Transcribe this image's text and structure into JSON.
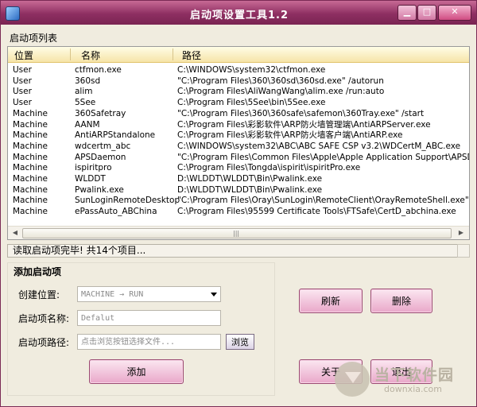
{
  "window": {
    "title": "启动项设置工具1.2",
    "controls": {
      "minimize": "▁",
      "maximize": "□",
      "close": "✕"
    },
    "accent_color": "#8e2f62"
  },
  "list_group": {
    "label": "启动项列表",
    "columns": [
      "位置",
      "名称",
      "路径"
    ],
    "rows": [
      [
        "User",
        "ctfmon.exe",
        "C:\\WINDOWS\\system32\\ctfmon.exe"
      ],
      [
        "User",
        "360sd",
        "\"C:\\Program Files\\360\\360sd\\360sd.exe\" /autorun"
      ],
      [
        "User",
        "alim",
        "C:\\Program Files\\AliWangWang\\alim.exe  /run:auto"
      ],
      [
        "User",
        "5See",
        "C:\\Program Files\\5See\\bin\\5See.exe"
      ],
      [
        "Machine",
        "360Safetray",
        "\"C:\\Program Files\\360\\360safe\\safemon\\360Tray.exe\" /start"
      ],
      [
        "Machine",
        "AANM",
        "C:\\Program Files\\彩影软件\\ARP防火墙管理端\\AntiARPServer.exe"
      ],
      [
        "Machine",
        "AntiARPStandalone",
        "C:\\Program Files\\彩影软件\\ARP防火墙客户端\\AntiARP.exe"
      ],
      [
        "Machine",
        "wdcertm_abc",
        "C:\\WINDOWS\\system32\\ABC\\ABC SAFE CSP v3.2\\WDCertM_ABC.exe"
      ],
      [
        "Machine",
        "APSDaemon",
        "\"C:\\Program Files\\Common Files\\Apple\\Apple Application Support\\APSDaemon"
      ],
      [
        "Machine",
        "ispiritpro",
        "C:\\Program Files\\Tongda\\ispirit\\ispiritPro.exe"
      ],
      [
        "Machine",
        "WLDDT",
        "D:\\WLDDT\\WLDDT\\Bin\\Pwalink.exe"
      ],
      [
        "Machine",
        "Pwalink.exe",
        "D:\\WLDDT\\WLDDT\\Bin\\Pwalink.exe"
      ],
      [
        "Machine",
        "SunLoginRemoteDesktop",
        "\"C:\\Program Files\\Oray\\SunLogin\\RemoteClient\\OrayRemoteShell.exe\" -autor"
      ],
      [
        "Machine",
        "ePassAuto_ABChina",
        "C:\\Program Files\\95599 Certificate Tools\\FTSafe\\CertD_abchina.exe"
      ]
    ],
    "scroll_left": "◀",
    "scroll_right": "▶",
    "scroll_grip": "|||"
  },
  "status": {
    "text": "读取启动项完毕! 共14个项目..."
  },
  "add_group": {
    "title": "添加启动项",
    "location_label": "创建位置:",
    "location_value": "MACHINE → RUN",
    "name_label": "启动项名称:",
    "name_placeholder": "Defalut",
    "path_label": "启动项路径:",
    "path_placeholder": "点击浏览按钮选择文件...",
    "browse_label": "浏览",
    "add_label": "添加"
  },
  "buttons": {
    "refresh": "刷新",
    "delete": "删除",
    "about": "关于",
    "exit": "退出"
  },
  "watermark": {
    "main": "当下软件园",
    "sub": "downxia.com"
  }
}
